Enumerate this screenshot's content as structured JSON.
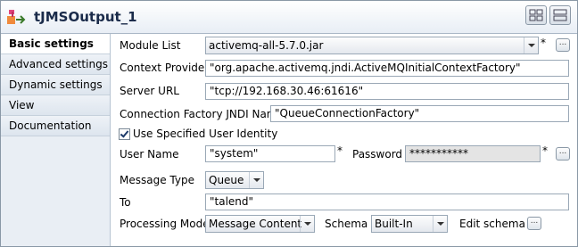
{
  "window": {
    "title": "tJMSOutput_1"
  },
  "tabs": [
    "Basic settings",
    "Advanced settings",
    "Dynamic settings",
    "View",
    "Documentation"
  ],
  "form": {
    "module_list": {
      "label": "Module List",
      "value": "activemq-all-5.7.0.jar",
      "required_mark": "*"
    },
    "context_provider": {
      "label": "Context Provider",
      "value": "\"org.apache.activemq.jndi.ActiveMQInitialContextFactory\""
    },
    "server_url": {
      "label": "Server URL",
      "value": "\"tcp://192.168.30.46:61616\""
    },
    "connection_factory": {
      "label": "Connection Factory JNDI Name",
      "value": "\"QueueConnectionFactory\""
    },
    "use_identity": {
      "label": "Use Specified User Identity",
      "checked": true
    },
    "user_name": {
      "label": "User Name",
      "value": "\"system\"",
      "required_mark": "*"
    },
    "password": {
      "label": "Password",
      "value": "***********",
      "required_mark": "*"
    },
    "message_type": {
      "label": "Message Type",
      "value": "Queue"
    },
    "to": {
      "label": "To",
      "value": "\"talend\""
    },
    "processing_mode": {
      "label": "Processing Mode",
      "value": "Message Content"
    },
    "schema": {
      "label": "Schema",
      "value": "Built-In"
    },
    "edit_schema": {
      "label": "Edit schema"
    },
    "more_button": "..."
  }
}
